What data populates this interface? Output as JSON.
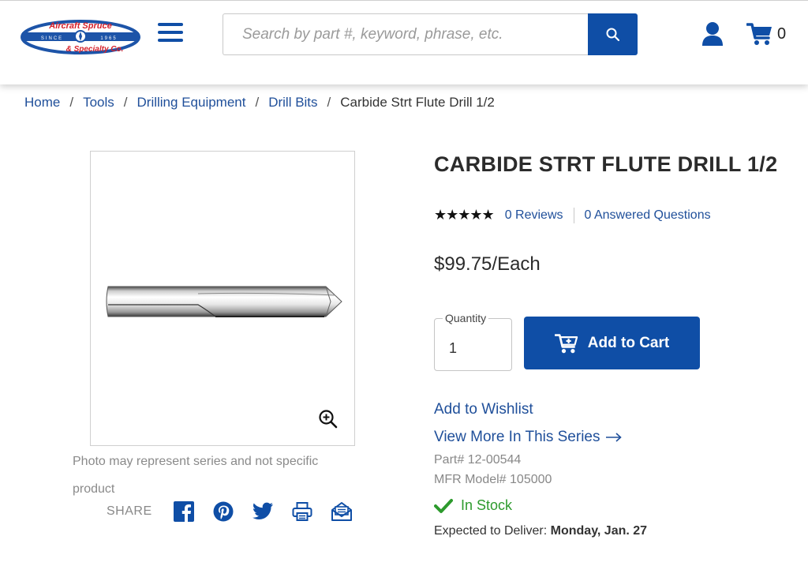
{
  "header": {
    "logo": {
      "line1": "Aircraft Spruce",
      "line2": "& Specialty Co.",
      "since": "SINCE",
      "year": "1965"
    },
    "search": {
      "placeholder": "Search by part #, keyword, phrase, etc."
    },
    "cart_count": "0",
    "icons": [
      "menu-icon",
      "search-icon",
      "account-icon",
      "cart-icon"
    ]
  },
  "breadcrumb": {
    "items": [
      "Home",
      "Tools",
      "Drilling Equipment",
      "Drill Bits"
    ],
    "separator": "/",
    "current": "Carbide Strt Flute Drill 1/2"
  },
  "gallery": {
    "photo_note": "Photo may represent series and not specific product",
    "share_label": "SHARE",
    "share_icons": [
      "facebook-icon",
      "pinterest-icon",
      "twitter-icon",
      "print-icon",
      "email-icon"
    ]
  },
  "product": {
    "title": "CARBIDE STRT FLUTE DRILL 1/2",
    "stars": "★★★★★",
    "reviews": "0 Reviews",
    "questions": "0 Answered Questions",
    "price": "$99.75/Each",
    "quantity_label": "Quantity",
    "quantity_value": "1",
    "add_to_cart": "Add to Cart",
    "wishlist": "Add to Wishlist",
    "series": "View More In This Series",
    "part_label": "Part#",
    "part_number": "12-00544",
    "mfr_label": "MFR Model#",
    "mfr_model": "105000",
    "stock": "In Stock",
    "deliver_label": "Expected to Deliver:",
    "deliver_date": "Monday, Jan. 27"
  },
  "colors": {
    "brand_blue": "#0f4ea6",
    "link_blue": "#1f4f9a",
    "stock_green": "#2d9a2d",
    "logo_red": "#d6202a"
  }
}
